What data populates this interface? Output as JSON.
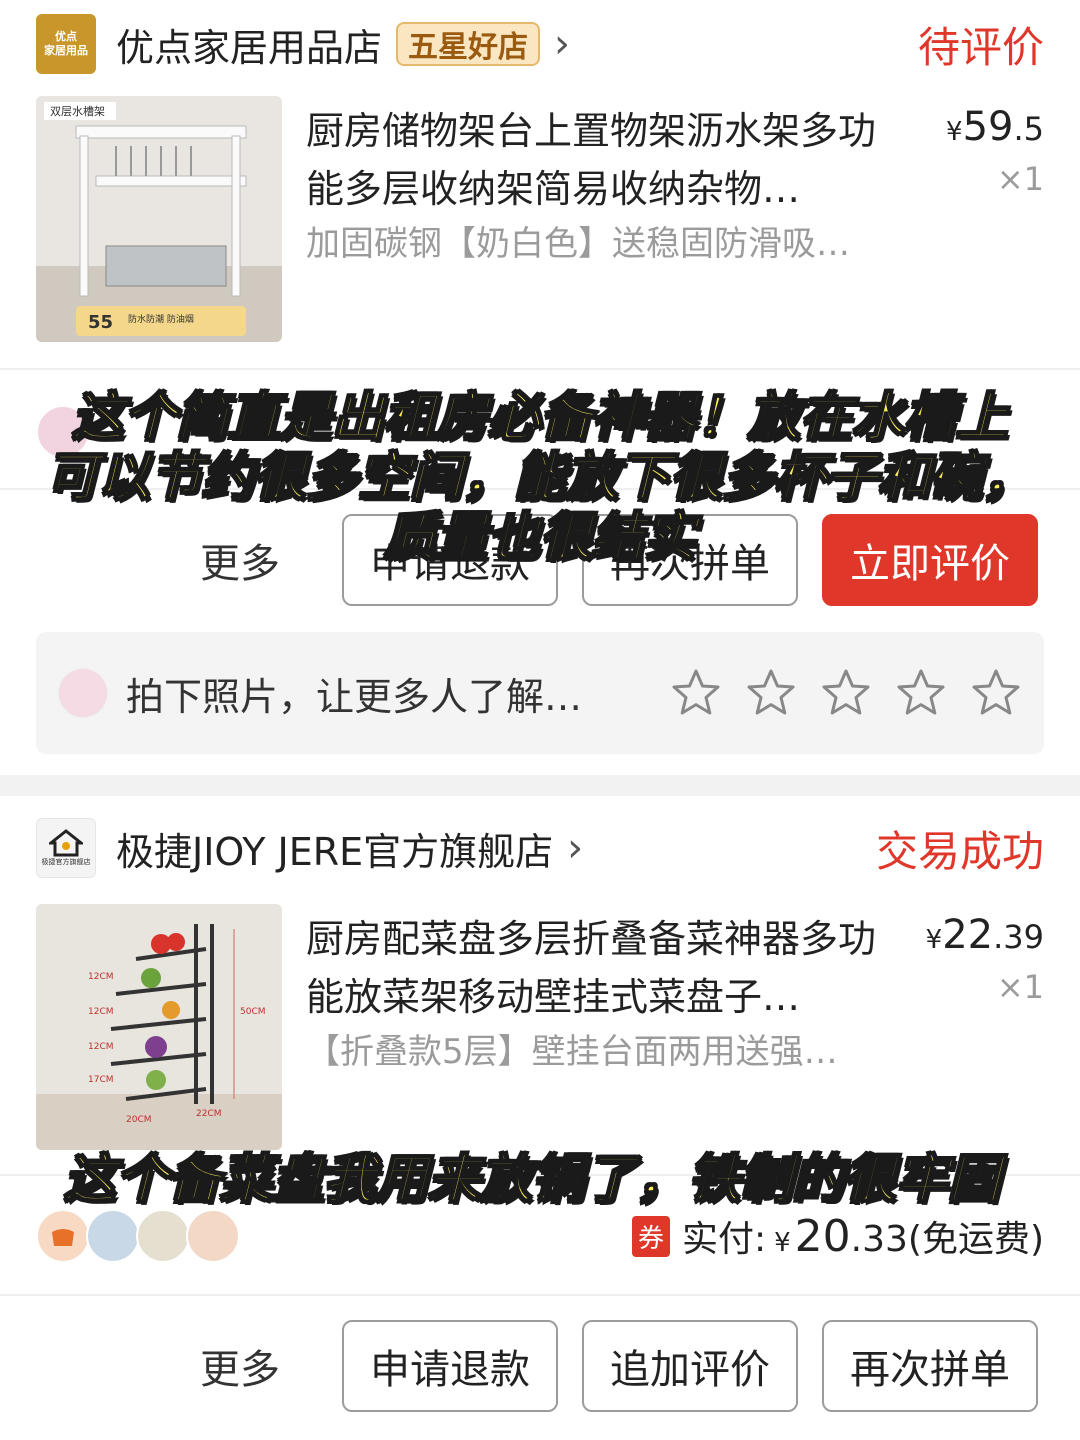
{
  "order1": {
    "store": {
      "logo_text_line1": "优点",
      "logo_text_line2": "家居用品",
      "name": "优点家居用品店",
      "badge": "五星好店",
      "chevron": "›"
    },
    "status": "待评价",
    "product": {
      "image_label_top": "双层水槽架",
      "image_label_size": "55",
      "image_label_features": "防水防潮 防油烟",
      "title": "厨房储物架台上置物架沥水架多功能多层收纳架简易收纳杂物…",
      "spec": "加固碳钢【奶白色】送稳固防滑吸…",
      "price_currency": "¥",
      "price_int": "59",
      "price_dec": ".5",
      "qty": "×1"
    },
    "buttons": {
      "more": "更多",
      "refund": "申请退款",
      "regroup": "再次拼单",
      "review_now": "立即评价"
    },
    "review_prompt": {
      "text": "拍下照片，让更多人了解…",
      "star_icon_count": 5
    }
  },
  "order2": {
    "store": {
      "logo_text": "极捷官方旗舰店",
      "name": "极捷JIOY JERE官方旗舰店",
      "chevron": "›"
    },
    "status": "交易成功",
    "product": {
      "image_labels": [
        "12CM",
        "12CM",
        "12CM",
        "17CM",
        "50CM",
        "20CM",
        "22CM"
      ],
      "title": "厨房配菜盘多层折叠备菜神器多功能放菜架移动壁挂式菜盘子…",
      "spec": "【折叠款5层】壁挂台面两用送强…",
      "price_currency": "¥",
      "price_int": "22",
      "price_dec": ".39",
      "qty": "×1"
    },
    "payment": {
      "coupon": "券",
      "label": "实付:",
      "currency": "¥",
      "int": "20",
      "dec": ".33",
      "shipping": "(免运费)"
    },
    "buttons": {
      "more": "更多",
      "refund": "申请退款",
      "add_review": "追加评价",
      "regroup": "再次拼单"
    }
  },
  "overlays": {
    "caption1_line1": "这个简直是出租房必备神器！放在水槽上",
    "caption1_line2": "可以节约很多空间，能放下很多杯子和碗，",
    "caption1_line3": "质量也很结实",
    "caption2": "这个备菜盘我用来放锅了，铁制的很牢固"
  },
  "colors": {
    "accent_red": "#e0372b",
    "caption_yellow": "#fff05a",
    "badge_bg": "#fbe6c2",
    "gray_text": "#9b9b9b"
  }
}
